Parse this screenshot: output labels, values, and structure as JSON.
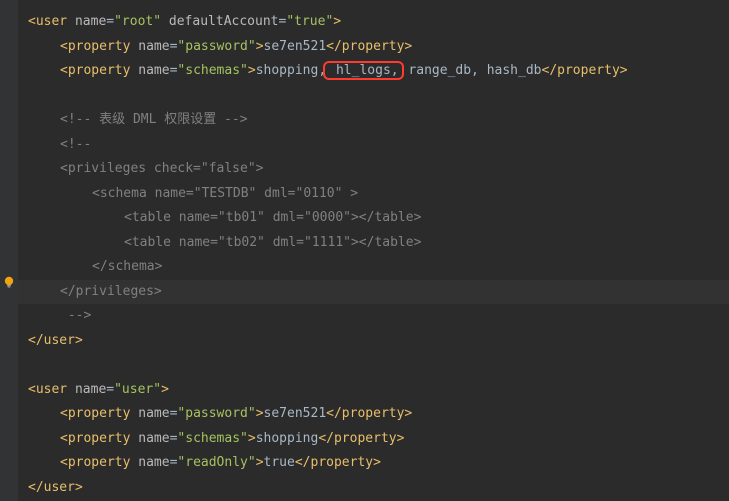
{
  "icons": {
    "bulb_fill": "#f0a30a"
  },
  "code": {
    "lines": [
      {
        "indent": 0,
        "tokens": [
          {
            "t": "tag",
            "v": "<user "
          },
          {
            "t": "attr",
            "v": "name"
          },
          {
            "t": "eq",
            "v": "="
          },
          {
            "t": "val",
            "v": "\"root\""
          },
          {
            "t": "tag",
            "v": " "
          },
          {
            "t": "attr",
            "v": "defaultAccount"
          },
          {
            "t": "eq",
            "v": "="
          },
          {
            "t": "val",
            "v": "\"true\""
          },
          {
            "t": "tag",
            "v": ">"
          }
        ]
      },
      {
        "indent": 1,
        "tokens": [
          {
            "t": "tag",
            "v": "<property "
          },
          {
            "t": "attr",
            "v": "name"
          },
          {
            "t": "eq",
            "v": "="
          },
          {
            "t": "val",
            "v": "\"password\""
          },
          {
            "t": "tag",
            "v": ">"
          },
          {
            "t": "text",
            "v": "se7en521"
          },
          {
            "t": "tag",
            "v": "</property>"
          }
        ]
      },
      {
        "indent": 1,
        "tokens": [
          {
            "t": "tag",
            "v": "<property "
          },
          {
            "t": "attr",
            "v": "name"
          },
          {
            "t": "eq",
            "v": "="
          },
          {
            "t": "val",
            "v": "\"schemas\""
          },
          {
            "t": "tag",
            "v": ">"
          },
          {
            "t": "text",
            "v": "shopping,"
          },
          {
            "t": "text-boxed",
            "v": " hl_logs,"
          },
          {
            "t": "text",
            "v": " range_db, hash_db"
          },
          {
            "t": "tag",
            "v": "</property>"
          }
        ]
      },
      {
        "indent": 0,
        "tokens": []
      },
      {
        "indent": 1,
        "tokens": [
          {
            "t": "comm",
            "v": "<!-- 表级 DML 权限设置 -->"
          }
        ]
      },
      {
        "indent": 1,
        "tokens": [
          {
            "t": "comm",
            "v": "<!--"
          }
        ]
      },
      {
        "indent": 1,
        "tokens": [
          {
            "t": "comm",
            "v": "<privileges check=\"false\">"
          }
        ]
      },
      {
        "indent": 2,
        "tokens": [
          {
            "t": "comm",
            "v": "<schema name=\"TESTDB\" dml=\"0110\" >"
          }
        ]
      },
      {
        "indent": 3,
        "tokens": [
          {
            "t": "comm",
            "v": "<table name=\"tb01\" dml=\"0000\"></table>"
          }
        ]
      },
      {
        "indent": 3,
        "tokens": [
          {
            "t": "comm",
            "v": "<table name=\"tb02\" dml=\"1111\"></table>"
          }
        ]
      },
      {
        "indent": 2,
        "tokens": [
          {
            "t": "comm",
            "v": "</schema>"
          }
        ]
      },
      {
        "indent": 1,
        "highlight": true,
        "tokens": [
          {
            "t": "comm",
            "v": "</privileges>"
          }
        ]
      },
      {
        "indent": 1,
        "tokens": [
          {
            "t": "comm",
            "v": " -->"
          }
        ]
      },
      {
        "indent": 0,
        "tokens": [
          {
            "t": "tag",
            "v": "</user>"
          }
        ]
      },
      {
        "indent": 0,
        "tokens": []
      },
      {
        "indent": 0,
        "tokens": [
          {
            "t": "tag",
            "v": "<user "
          },
          {
            "t": "attr",
            "v": "name"
          },
          {
            "t": "eq",
            "v": "="
          },
          {
            "t": "val",
            "v": "\"user\""
          },
          {
            "t": "tag",
            "v": ">"
          }
        ]
      },
      {
        "indent": 1,
        "tokens": [
          {
            "t": "tag",
            "v": "<property "
          },
          {
            "t": "attr",
            "v": "name"
          },
          {
            "t": "eq",
            "v": "="
          },
          {
            "t": "val",
            "v": "\"password\""
          },
          {
            "t": "tag",
            "v": ">"
          },
          {
            "t": "text",
            "v": "se7en521"
          },
          {
            "t": "tag",
            "v": "</property>"
          }
        ]
      },
      {
        "indent": 1,
        "tokens": [
          {
            "t": "tag",
            "v": "<property "
          },
          {
            "t": "attr",
            "v": "name"
          },
          {
            "t": "eq",
            "v": "="
          },
          {
            "t": "val",
            "v": "\"schemas\""
          },
          {
            "t": "tag",
            "v": ">"
          },
          {
            "t": "text",
            "v": "shopping"
          },
          {
            "t": "tag",
            "v": "</property>"
          }
        ]
      },
      {
        "indent": 1,
        "tokens": [
          {
            "t": "tag",
            "v": "<property "
          },
          {
            "t": "attr",
            "v": "name"
          },
          {
            "t": "eq",
            "v": "="
          },
          {
            "t": "val",
            "v": "\"readOnly\""
          },
          {
            "t": "tag",
            "v": ">"
          },
          {
            "t": "text",
            "v": "true"
          },
          {
            "t": "tag",
            "v": "</property>"
          }
        ]
      },
      {
        "indent": 0,
        "tokens": [
          {
            "t": "tag",
            "v": "</user>"
          }
        ]
      }
    ]
  }
}
